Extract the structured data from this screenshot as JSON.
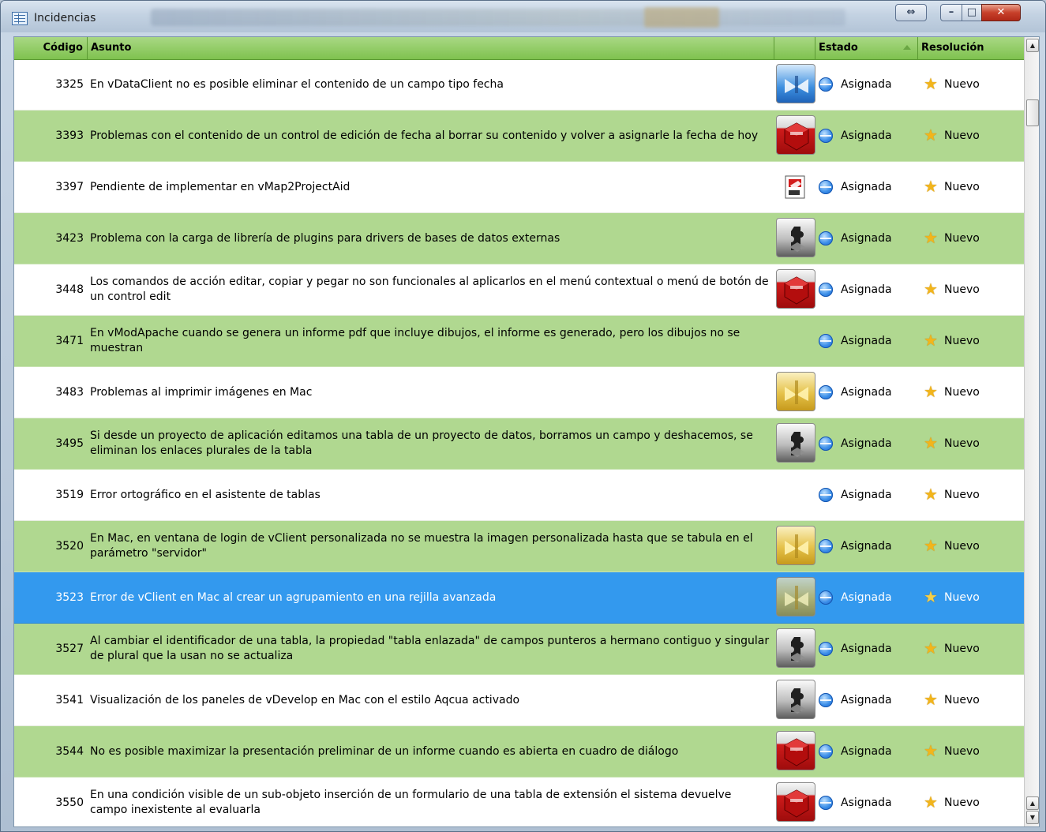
{
  "window": {
    "title": "Incidencias",
    "restore_glyph": "⇔",
    "minimize_glyph": "–",
    "maximize_glyph": "□",
    "close_glyph": "✕"
  },
  "columns": {
    "code": "Código",
    "subject": "Asunto",
    "image": "",
    "status": "Estado",
    "resolution": "Resolución"
  },
  "rows": [
    {
      "code": "3325",
      "subject": "En vDataClient no es posible eliminar el contenido de un campo tipo fecha",
      "icon": "blue-diamond-icon",
      "status": "Asignada",
      "resolution": "Nuevo",
      "style": "normal"
    },
    {
      "code": "3393",
      "subject": "Problemas con el contenido de un control de edición de fecha al borrar su contenido y volver a asignarle la fecha de hoy",
      "icon": "red-cube-icon",
      "status": "Asignada",
      "resolution": "Nuevo",
      "style": "alt"
    },
    {
      "code": "3397",
      "subject": "Pendiente de implementar en vMap2ProjectAid",
      "icon": "document-map-icon",
      "status": "Asignada",
      "resolution": "Nuevo",
      "style": "normal"
    },
    {
      "code": "3423",
      "subject": "Problema con la carga de librería de plugins para drivers de bases de datos externas",
      "icon": "dark-puzzle-icon",
      "status": "Asignada",
      "resolution": "Nuevo",
      "style": "alt"
    },
    {
      "code": "3448",
      "subject": "Los comandos de acción editar, copiar y pegar no son funcionales al aplicarlos en el menú contextual o menú de botón de un control edit",
      "icon": "red-cube-icon",
      "status": "Asignada",
      "resolution": "Nuevo",
      "style": "normal"
    },
    {
      "code": "3471",
      "subject": "En vModApache cuando se genera un informe pdf que incluye dibujos, el informe es generado, pero los dibujos no se muestran",
      "icon": "",
      "status": "Asignada",
      "resolution": "Nuevo",
      "style": "alt"
    },
    {
      "code": "3483",
      "subject": "Problemas al imprimir imágenes en Mac",
      "icon": "gold-diamond-icon",
      "status": "Asignada",
      "resolution": "Nuevo",
      "style": "normal"
    },
    {
      "code": "3495",
      "subject": "Si desde un proyecto de aplicación editamos una tabla de un proyecto de datos, borramos un campo y deshacemos, se eliminan los enlaces plurales de la tabla",
      "icon": "dark-puzzle-icon",
      "status": "Asignada",
      "resolution": "Nuevo",
      "style": "alt"
    },
    {
      "code": "3519",
      "subject": "Error ortográfico en el asistente de tablas",
      "icon": "",
      "status": "Asignada",
      "resolution": "Nuevo",
      "style": "normal"
    },
    {
      "code": "3520",
      "subject": "En Mac, en ventana de login de vClient personalizada no se muestra la imagen personalizada hasta que se tabula en el parámetro \"servidor\"",
      "icon": "gold-diamond-icon",
      "status": "Asignada",
      "resolution": "Nuevo",
      "style": "alt"
    },
    {
      "code": "3523",
      "subject": "Error de vClient en Mac al crear un agrupamiento en una rejilla avanzada",
      "icon": "gold-diamond-icon",
      "status": "Asignada",
      "resolution": "Nuevo",
      "style": "selected"
    },
    {
      "code": "3527",
      "subject": "Al cambiar el identificador de una tabla, la propiedad \"tabla enlazada\" de campos punteros a hermano contiguo y singular de plural que la usan no se actualiza",
      "icon": "dark-puzzle-icon",
      "status": "Asignada",
      "resolution": "Nuevo",
      "style": "alt"
    },
    {
      "code": "3541",
      "subject": "Visualización de los paneles de vDevelop en Mac con el estilo Aqcua activado",
      "icon": "dark-puzzle-icon",
      "status": "Asignada",
      "resolution": "Nuevo",
      "style": "normal"
    },
    {
      "code": "3544",
      "subject": "No es posible maximizar la presentación preliminar de un informe cuando es abierta en cuadro de diálogo",
      "icon": "red-cube-icon",
      "status": "Asignada",
      "resolution": "Nuevo",
      "style": "alt"
    },
    {
      "code": "3550",
      "subject": "En una condición visible de un sub-objeto inserción de un formulario de una tabla de extensión el sistema devuelve campo inexistente al evaluarla",
      "icon": "red-cube-icon",
      "status": "Asignada",
      "resolution": "Nuevo",
      "style": "normal"
    }
  ],
  "colors": {
    "header_green": "#7fc24f",
    "row_alt_green": "#b0d890",
    "selection_blue": "#3399ee",
    "status_blue": "#3b8ee8",
    "star_gold": "#f2b51c"
  },
  "scrollbar": {
    "up_glyph": "▲",
    "down_glyph": "▼"
  }
}
